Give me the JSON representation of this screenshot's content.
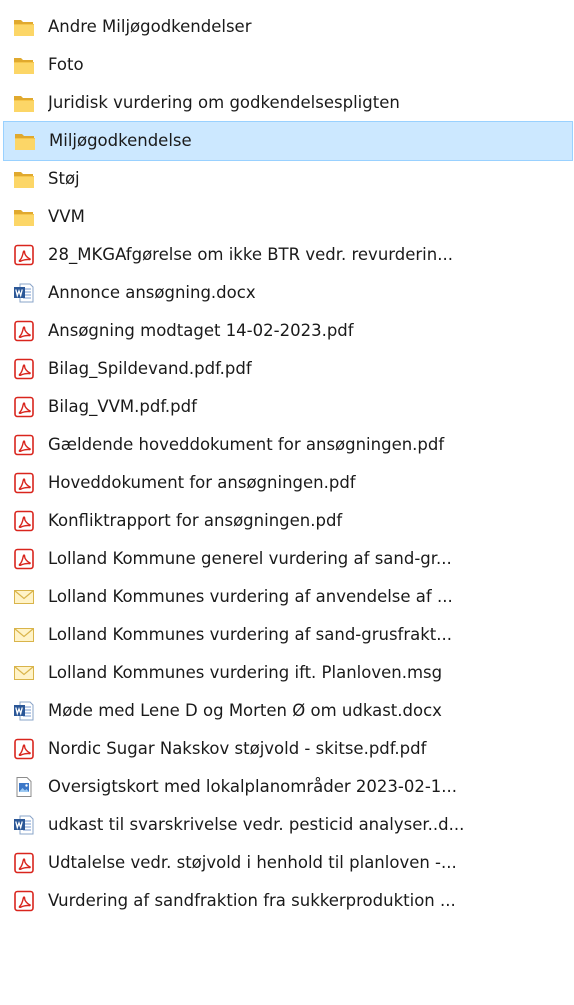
{
  "files": [
    {
      "name": "Andre Miljøgodkendelser",
      "type": "folder",
      "icon": "folder-icon",
      "selected": false
    },
    {
      "name": "Foto",
      "type": "folder",
      "icon": "folder-icon",
      "selected": false
    },
    {
      "name": "Juridisk vurdering om godkendelsespligten",
      "type": "folder",
      "icon": "folder-icon",
      "selected": false
    },
    {
      "name": "Miljøgodkendelse",
      "type": "folder",
      "icon": "folder-icon",
      "selected": true
    },
    {
      "name": "Støj",
      "type": "folder",
      "icon": "folder-icon",
      "selected": false
    },
    {
      "name": "VVM",
      "type": "folder",
      "icon": "folder-icon",
      "selected": false
    },
    {
      "name": "28_MKGAfgørelse om ikke BTR vedr. revurderin...",
      "type": "pdf",
      "icon": "pdf-icon",
      "selected": false
    },
    {
      "name": "Annonce ansøgning.docx",
      "type": "docx",
      "icon": "word-icon",
      "selected": false
    },
    {
      "name": "Ansøgning modtaget 14-02-2023.pdf",
      "type": "pdf",
      "icon": "pdf-icon",
      "selected": false
    },
    {
      "name": "Bilag_Spildevand.pdf.pdf",
      "type": "pdf",
      "icon": "pdf-icon",
      "selected": false
    },
    {
      "name": "Bilag_VVM.pdf.pdf",
      "type": "pdf",
      "icon": "pdf-icon",
      "selected": false
    },
    {
      "name": "Gældende hoveddokument for ansøgningen.pdf",
      "type": "pdf",
      "icon": "pdf-icon",
      "selected": false
    },
    {
      "name": "Hoveddokument for ansøgningen.pdf",
      "type": "pdf",
      "icon": "pdf-icon",
      "selected": false
    },
    {
      "name": "Konfliktrapport for ansøgningen.pdf",
      "type": "pdf",
      "icon": "pdf-icon",
      "selected": false
    },
    {
      "name": "Lolland Kommune generel vurdering af sand-gr...",
      "type": "pdf",
      "icon": "pdf-icon",
      "selected": false
    },
    {
      "name": "Lolland Kommunes vurdering af anvendelse af ...",
      "type": "msg",
      "icon": "mail-icon",
      "selected": false
    },
    {
      "name": "Lolland Kommunes vurdering af sand-grusfrakt...",
      "type": "msg",
      "icon": "mail-icon",
      "selected": false
    },
    {
      "name": "Lolland Kommunes vurdering ift. Planloven.msg",
      "type": "msg",
      "icon": "mail-icon",
      "selected": false
    },
    {
      "name": "Møde med Lene D og Morten Ø om udkast.docx",
      "type": "docx",
      "icon": "word-icon",
      "selected": false
    },
    {
      "name": "Nordic Sugar Nakskov støjvold - skitse.pdf.pdf",
      "type": "pdf",
      "icon": "pdf-icon",
      "selected": false
    },
    {
      "name": "Oversigtskort med lokalplanområder 2023-02-1...",
      "type": "image",
      "icon": "image-file-icon",
      "selected": false
    },
    {
      "name": "udkast til svarskrivelse vedr. pesticid analyser..d...",
      "type": "docx",
      "icon": "word-icon",
      "selected": false
    },
    {
      "name": "Udtalelse vedr. støjvold i henhold til planloven -...",
      "type": "pdf",
      "icon": "pdf-icon",
      "selected": false
    },
    {
      "name": "Vurdering af sandfraktion fra sukkerproduktion ...",
      "type": "pdf",
      "icon": "pdf-icon",
      "selected": false
    }
  ]
}
